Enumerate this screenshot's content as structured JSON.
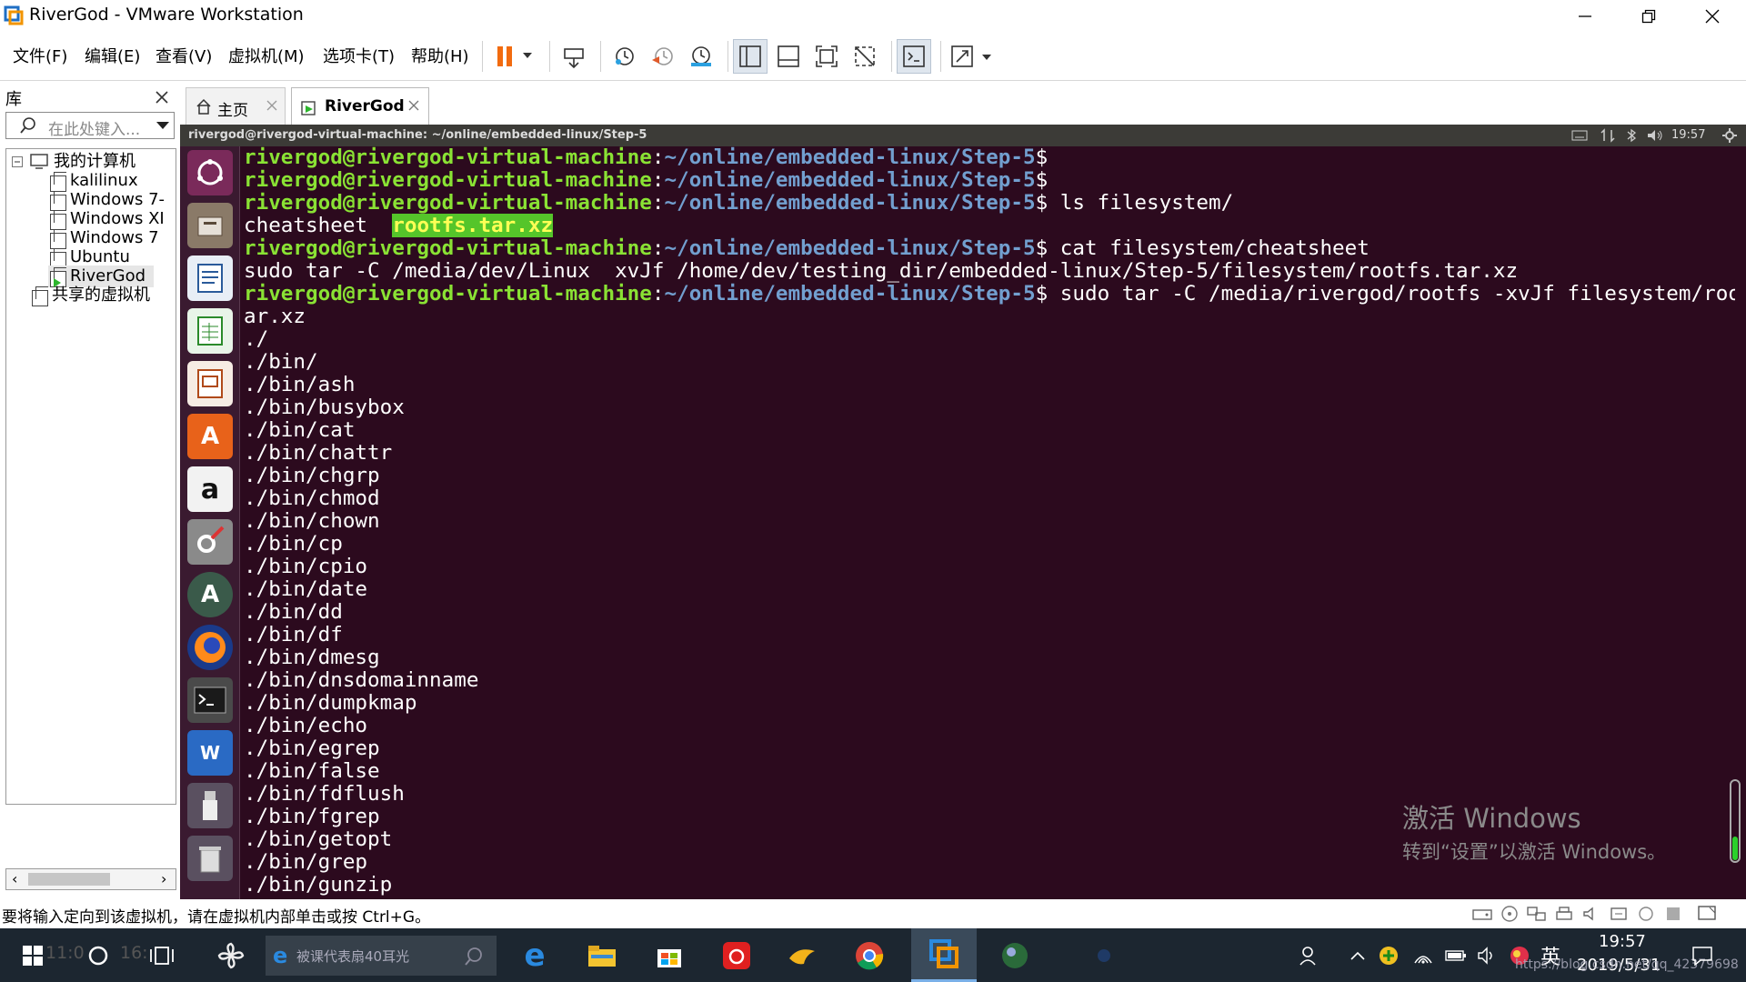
{
  "window": {
    "title": "RiverGod - VMware Workstation"
  },
  "menu": [
    "文件(F)",
    "编辑(E)",
    "查看(V)",
    "虚拟机(M)",
    "选项卡(T)",
    "帮助(H)"
  ],
  "library": {
    "title": "库",
    "search_placeholder": "在此处键入...",
    "tree": {
      "root": "我的计算机",
      "vms": [
        "kalilinux",
        "Windows 7-",
        "Windows XI",
        "Windows 7",
        "Ubuntu",
        "RiverGod"
      ],
      "shared": "共享的虚拟机"
    }
  },
  "tabs": [
    {
      "label": "主页",
      "icon": "home-icon"
    },
    {
      "label": "RiverGod",
      "icon": "vm-tab-icon",
      "active": true
    }
  ],
  "guest": {
    "top_bar_title": "rivergod@rivergod-virtual-machine: ~/online/embedded-linux/Step-5",
    "clock": "19:57",
    "launcher_icons": [
      "ubuntu-dash-icon",
      "files-icon",
      "writer-icon",
      "calc-icon",
      "impress-icon",
      "software-center-icon",
      "amazon-icon",
      "system-settings-icon",
      "software-updater-icon",
      "firefox-icon",
      "terminal-icon",
      "wps-icon",
      "usb-drive-icon",
      "trash-icon"
    ]
  },
  "terminal": {
    "prompt_user": "rivergod@rivergod-virtual-machine",
    "prompt_path": "~/online/embedded-linux/Step-5",
    "lines": [
      {
        "type": "prompt",
        "cmd": ""
      },
      {
        "type": "prompt",
        "cmd": ""
      },
      {
        "type": "prompt",
        "cmd": " ls filesystem/"
      },
      {
        "type": "ls",
        "a": "cheatsheet",
        "b": "rootfs.tar.xz"
      },
      {
        "type": "prompt",
        "cmd": " cat filesystem/cheatsheet"
      },
      {
        "type": "out",
        "text": "sudo tar -C /media/dev/Linux  xvJf /home/dev/testing_dir/embedded-linux/Step-5/filesystem/rootfs.tar.xz"
      },
      {
        "type": "prompt",
        "cmd": " sudo tar -C /media/rivergod/rootfs -xvJf filesystem/rootfs.t"
      },
      {
        "type": "out",
        "text": "ar.xz"
      },
      {
        "type": "out",
        "text": "./"
      },
      {
        "type": "out",
        "text": "./bin/"
      },
      {
        "type": "out",
        "text": "./bin/ash"
      },
      {
        "type": "out",
        "text": "./bin/busybox"
      },
      {
        "type": "out",
        "text": "./bin/cat"
      },
      {
        "type": "out",
        "text": "./bin/chattr"
      },
      {
        "type": "out",
        "text": "./bin/chgrp"
      },
      {
        "type": "out",
        "text": "./bin/chmod"
      },
      {
        "type": "out",
        "text": "./bin/chown"
      },
      {
        "type": "out",
        "text": "./bin/cp"
      },
      {
        "type": "out",
        "text": "./bin/cpio"
      },
      {
        "type": "out",
        "text": "./bin/date"
      },
      {
        "type": "out",
        "text": "./bin/dd"
      },
      {
        "type": "out",
        "text": "./bin/df"
      },
      {
        "type": "out",
        "text": "./bin/dmesg"
      },
      {
        "type": "out",
        "text": "./bin/dnsdomainname"
      },
      {
        "type": "out",
        "text": "./bin/dumpkmap"
      },
      {
        "type": "out",
        "text": "./bin/echo"
      },
      {
        "type": "out",
        "text": "./bin/egrep"
      },
      {
        "type": "out",
        "text": "./bin/false"
      },
      {
        "type": "out",
        "text": "./bin/fdflush"
      },
      {
        "type": "out",
        "text": "./bin/fgrep"
      },
      {
        "type": "out",
        "text": "./bin/getopt"
      },
      {
        "type": "out",
        "text": "./bin/grep"
      },
      {
        "type": "out",
        "text": "./bin/gunzip"
      }
    ]
  },
  "activation": {
    "line1": "激活 Windows",
    "line2": "转到“设置”以激活 Windows。"
  },
  "status_bar": {
    "text": "要将输入定向到该虚拟机，请在虚拟机内部单击或按 Ctrl+G。"
  },
  "taskbar": {
    "search_text": "被课代表扇40耳光",
    "faded_time": "11:0",
    "faded_num": "16:",
    "ime": "英",
    "time": "19:57",
    "date": "2019/5/31",
    "watermark_url": "https://blog.csdn.net/qq_42379698",
    "colors": {
      "bg": "#1c2630",
      "accent": "#0078d7"
    }
  },
  "colors": {
    "terminal_bg": "#2c0a1e",
    "prompt_user": "#8ae234",
    "prompt_path": "#729fcf",
    "highlight_bg": "#55c52a"
  }
}
